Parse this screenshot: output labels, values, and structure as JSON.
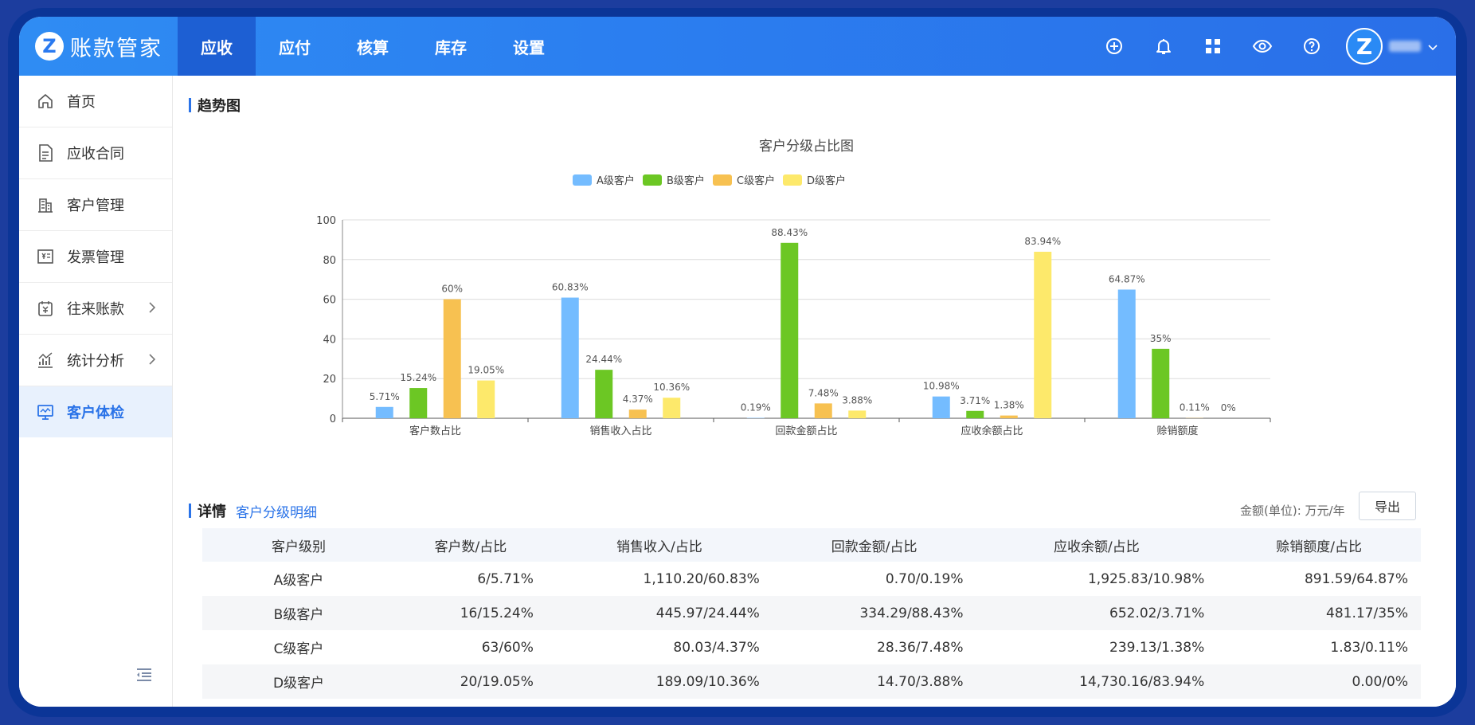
{
  "app": {
    "logo_letter": "Z",
    "name": "账款管家"
  },
  "nav": [
    {
      "label": "应收",
      "active": true
    },
    {
      "label": "应付",
      "active": false
    },
    {
      "label": "核算",
      "active": false
    },
    {
      "label": "库存",
      "active": false
    },
    {
      "label": "设置",
      "active": false
    }
  ],
  "header_tools": [
    "plus-circle-icon",
    "bell-icon",
    "apps-grid-icon",
    "eye-icon",
    "help-icon"
  ],
  "user": {
    "avatar_letter": "Z"
  },
  "sidebar": {
    "items": [
      {
        "label": "首页",
        "icon": "home-icon"
      },
      {
        "label": "应收合同",
        "icon": "document-icon"
      },
      {
        "label": "客户管理",
        "icon": "building-icon"
      },
      {
        "label": "发票管理",
        "icon": "invoice-icon"
      },
      {
        "label": "往来账款",
        "icon": "ledger-icon",
        "has_children": true
      },
      {
        "label": "统计分析",
        "icon": "stats-icon",
        "has_children": true
      },
      {
        "label": "客户体检",
        "icon": "monitor-icon",
        "active": true
      }
    ]
  },
  "trend": {
    "title": "趋势图"
  },
  "chart_data": {
    "type": "bar",
    "title": "客户分级占比图",
    "categories": [
      "客户数占比",
      "销售收入占比",
      "回款金额占比",
      "应收余额占比",
      "赊销额度"
    ],
    "series": [
      {
        "name": "A级客户",
        "color": "#74bcff",
        "values": [
          5.71,
          60.83,
          0.19,
          10.98,
          64.87
        ],
        "labels": [
          "5.71%",
          "60.83%",
          "0.19%",
          "10.98%",
          "64.87%"
        ]
      },
      {
        "name": "B级客户",
        "color": "#6cc724",
        "values": [
          15.24,
          24.44,
          88.43,
          3.71,
          35
        ],
        "labels": [
          "15.24%",
          "24.44%",
          "88.43%",
          "3.71%",
          "35%"
        ]
      },
      {
        "name": "C级客户",
        "color": "#f7c151",
        "values": [
          60,
          4.37,
          7.48,
          1.38,
          0.11
        ],
        "labels": [
          "60%",
          "4.37%",
          "7.48%",
          "1.38%",
          "0.11%"
        ]
      },
      {
        "name": "D级客户",
        "color": "#fde96b",
        "values": [
          19.05,
          10.36,
          3.88,
          83.94,
          0
        ],
        "labels": [
          "19.05%",
          "10.36%",
          "3.88%",
          "83.94%",
          "0%"
        ]
      }
    ],
    "ylim": [
      0,
      100
    ],
    "yticks": [
      "0",
      "20",
      "40",
      "60",
      "80",
      "100"
    ],
    "grid": true,
    "legend": "top-center"
  },
  "detail": {
    "title": "详情",
    "sub_link": "客户分级明细",
    "unit": "金额(单位): 万元/年",
    "export_label": "导出",
    "headers": [
      "客户级别",
      "客户数/占比",
      "销售收入/占比",
      "回款金额/占比",
      "应收余额/占比",
      "赊销额度/占比"
    ],
    "rows": [
      [
        "A级客户",
        "6/5.71%",
        "1,110.20/60.83%",
        "0.70/0.19%",
        "1,925.83/10.98%",
        "891.59/64.87%"
      ],
      [
        "B级客户",
        "16/15.24%",
        "445.97/24.44%",
        "334.29/88.43%",
        "652.02/3.71%",
        "481.17/35%"
      ],
      [
        "C级客户",
        "63/60%",
        "80.03/4.37%",
        "28.36/7.48%",
        "239.13/1.38%",
        "1.83/0.11%"
      ],
      [
        "D级客户",
        "20/19.05%",
        "189.09/10.36%",
        "14.70/3.88%",
        "14,730.16/83.94%",
        "0.00/0%"
      ]
    ]
  }
}
